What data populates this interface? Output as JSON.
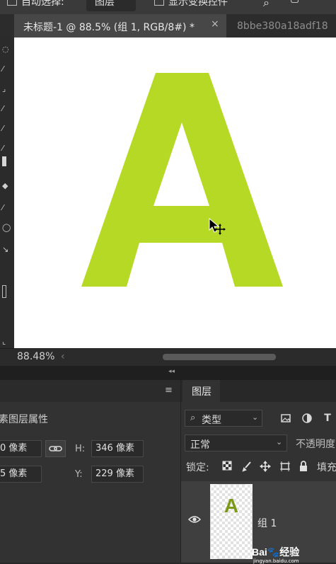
{
  "options_bar": {
    "auto_select_label": "自动选择:",
    "auto_select_value": "图层",
    "show_transform_label": "显示变换控件"
  },
  "document": {
    "active_tab_title": "未标题-1 @ 88.5% (组 1, RGB/8#) *",
    "close_glyph": "×",
    "second_tab_title": "8bbe380a18adf18",
    "canvas_letter": "A",
    "letter_color": "#b5d924"
  },
  "status_bar": {
    "zoom": "88.48%",
    "scroll_left_glyph": "‹"
  },
  "properties_panel": {
    "menu_glyph": "≡",
    "title": "素图层属性",
    "w_value": "0 像素",
    "h_label": "H:",
    "h_value": "346 像素",
    "x_value": "5 像素",
    "y_label": "Y:",
    "y_value": "229 像素",
    "link_icon": "link-icon"
  },
  "layers_panel": {
    "tab_label": "图层",
    "filter_icon": "⌕",
    "filter_value": "类型",
    "chevron": "⌄",
    "filter_icons": [
      "image-filter-icon",
      "adjustment-filter-icon",
      "type-filter-icon"
    ],
    "type_glyph": "T",
    "blend_mode": "正常",
    "opacity_label": "不透明度",
    "lock_label": "锁定:",
    "fill_label": "填充",
    "layers": [
      {
        "name": "组 1",
        "thumb_letter": "A",
        "visible": true
      }
    ]
  },
  "watermark": {
    "logo": "Bai🐾经验",
    "url": "jingyan.baidu.com"
  },
  "colors": {
    "accent_green": "#b5d924",
    "panel_bg": "#323232",
    "canvas_bg": "#ffffff"
  }
}
